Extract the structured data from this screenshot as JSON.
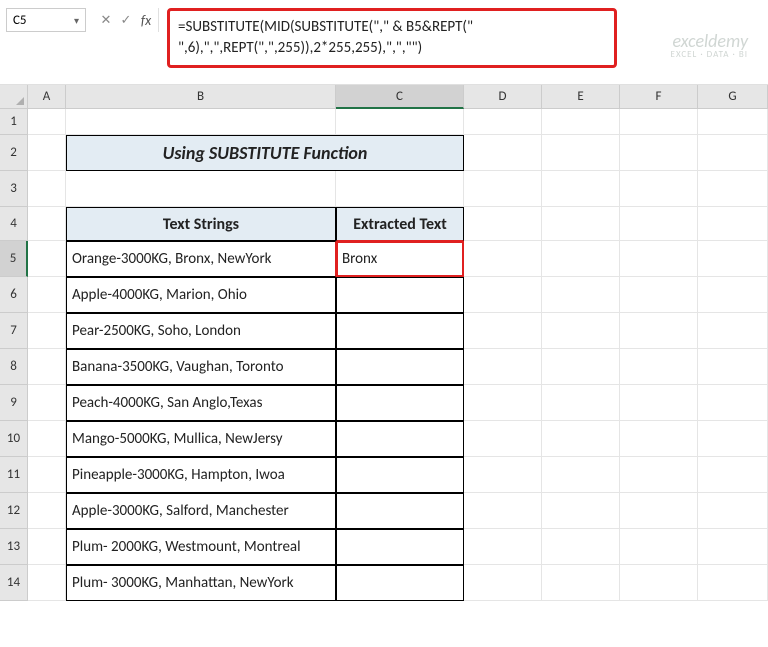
{
  "nameBox": "C5",
  "formula": "=SUBSTITUTE(MID(SUBSTITUTE(\",\" & B5&REPT(\" \",6),\",\",REPT(\",\",255)),2*255,255),\",\",\"\")",
  "columns": [
    "A",
    "B",
    "C",
    "D",
    "E",
    "F",
    "G"
  ],
  "rows": [
    "1",
    "2",
    "3",
    "4",
    "5",
    "6",
    "7",
    "8",
    "9",
    "10",
    "11",
    "12",
    "13",
    "14"
  ],
  "selected": {
    "col": "C",
    "row": "5"
  },
  "title": "Using SUBSTITUTE Function",
  "headers": {
    "b": "Text Strings",
    "c": "Extracted Text"
  },
  "data": [
    {
      "b": "Orange-3000KG, Bronx, NewYork",
      "c": "Bronx"
    },
    {
      "b": "Apple-4000KG, Marion, Ohio",
      "c": ""
    },
    {
      "b": "Pear-2500KG, Soho, London",
      "c": ""
    },
    {
      "b": "Banana-3500KG, Vaughan, Toronto",
      "c": ""
    },
    {
      "b": "Peach-4000KG, San Anglo,Texas",
      "c": ""
    },
    {
      "b": "Mango-5000KG, Mullica, NewJersy",
      "c": ""
    },
    {
      "b": "Pineapple-3000KG, Hampton, Iwoa",
      "c": ""
    },
    {
      "b": "Apple-3000KG, Salford, Manchester",
      "c": ""
    },
    {
      "b": "Plum- 2000KG, Westmount, Montreal",
      "c": ""
    },
    {
      "b": "Plum- 3000KG, Manhattan, NewYork",
      "c": ""
    }
  ],
  "watermark": {
    "main": "exceldemy",
    "sub": "EXCEL · DATA · BI"
  }
}
